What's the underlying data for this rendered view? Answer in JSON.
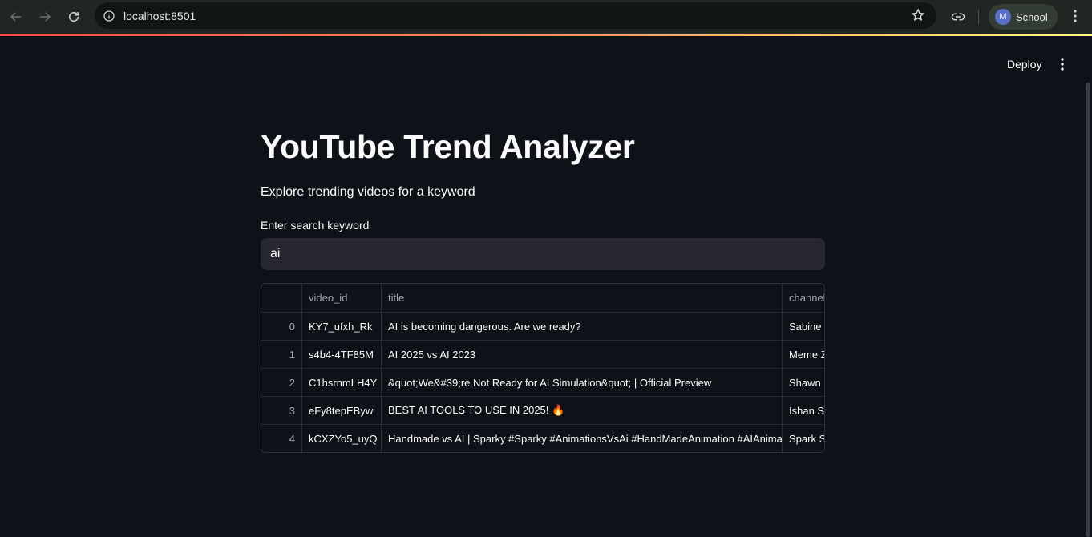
{
  "browser": {
    "url": "localhost:8501",
    "profile_initial": "M",
    "profile_name": "School"
  },
  "app": {
    "deploy_label": "Deploy",
    "title": "YouTube Trend Analyzer",
    "subtitle": "Explore trending videos for a keyword",
    "search_label": "Enter search keyword",
    "search_value": "ai"
  },
  "table": {
    "columns": [
      "",
      "video_id",
      "title",
      "channel"
    ],
    "rows": [
      {
        "index": "0",
        "video_id": "KY7_ufxh_Rk",
        "title": "AI is becoming dangerous. Are we ready?",
        "channel": "Sabine Hossenfelder"
      },
      {
        "index": "1",
        "video_id": "s4b4-4TF85M",
        "title": "AI 2025 vs AI 2023",
        "channel": "Meme Zone"
      },
      {
        "index": "2",
        "video_id": "C1hsrnmLH4Y",
        "title": "&quot;We&#39;re Not Ready for AI Simulation&quot; | Official Preview",
        "channel": "Shawn Ryan Show"
      },
      {
        "index": "3",
        "video_id": "eFy8tepEByw",
        "title": "BEST AI TOOLS TO USE IN 2025! 🔥",
        "channel": "Ishan Sharma"
      },
      {
        "index": "4",
        "video_id": "kCXZYo5_uyQ",
        "title": "Handmade vs AI | Sparky #Sparky #AnimationsVsAi #HandMadeAnimation #AIAnimation",
        "channel": "Spark Studio"
      }
    ]
  },
  "colors": {
    "background": "#0e1117",
    "input_bg": "#262730",
    "accent_gradient": [
      "#ff4b4b",
      "#fffd80"
    ]
  }
}
